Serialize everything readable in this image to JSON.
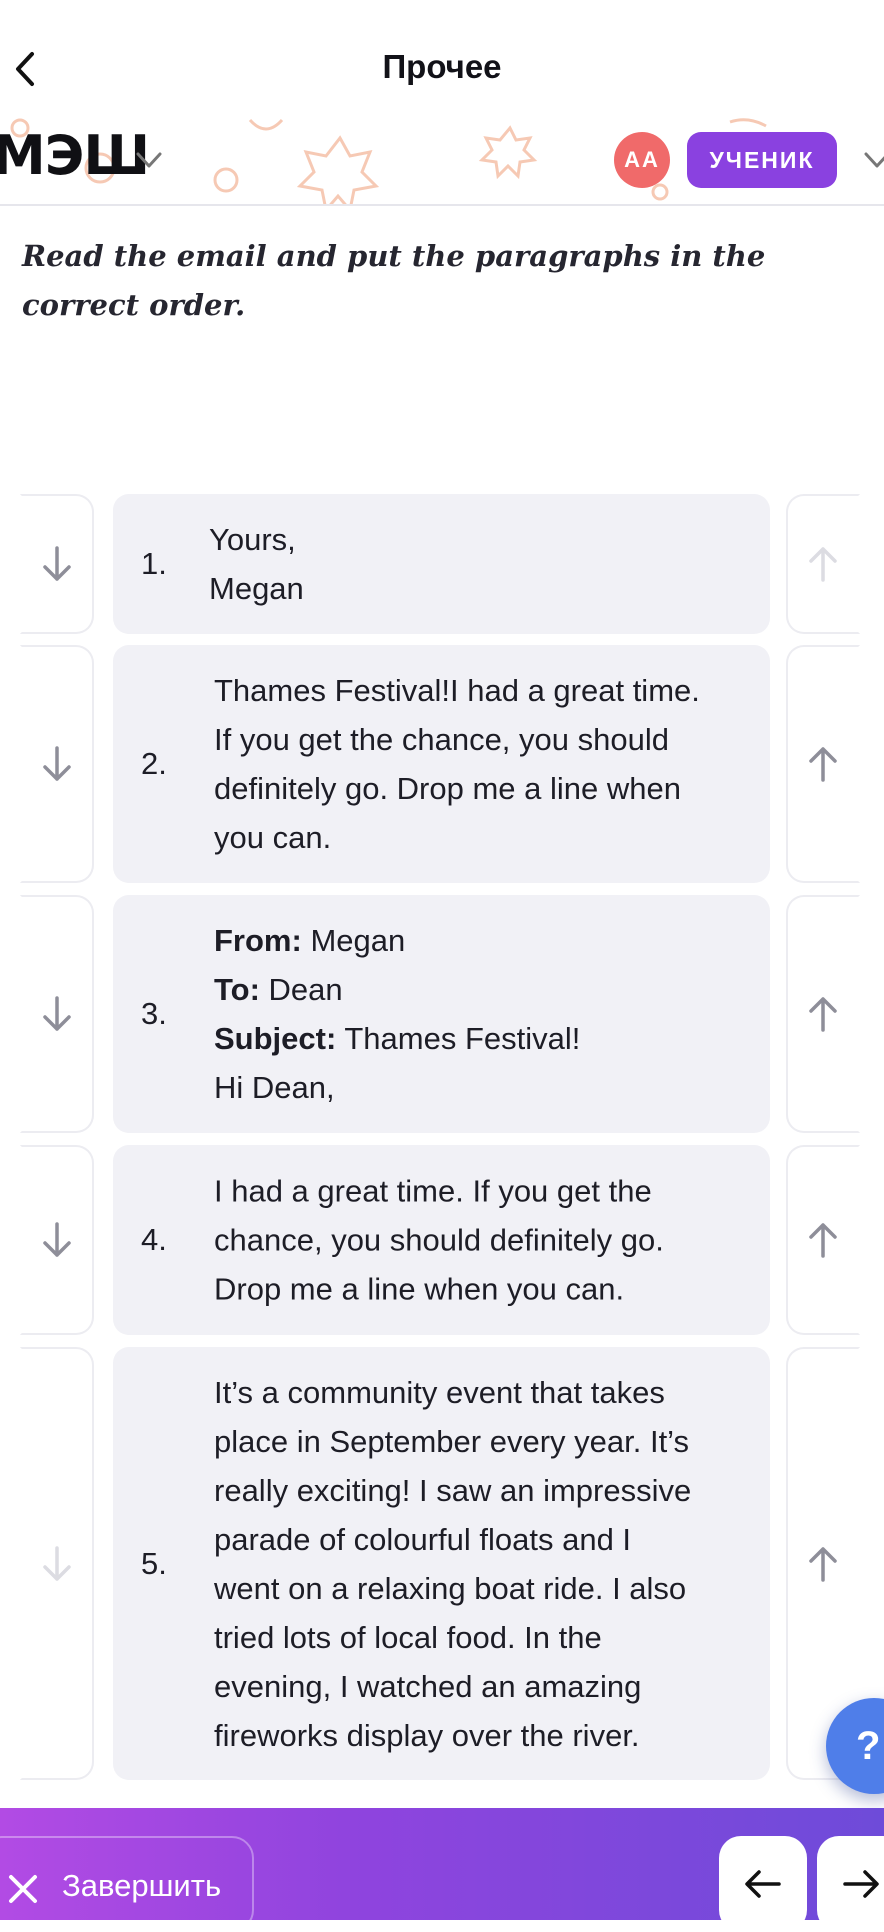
{
  "nav": {
    "title": "Прочее"
  },
  "banner": {
    "logo_text": "ЭШ",
    "logo_prefix": "М",
    "avatar_initials": "AA",
    "role_label": "УЧЕНИК"
  },
  "task": {
    "instruction": "Read the email and put the paragraphs in the correct order."
  },
  "items": [
    {
      "number": "1.",
      "lines": [
        "Yours,",
        "Megan"
      ],
      "down_enabled": true,
      "up_enabled": false
    },
    {
      "number": "2.",
      "lines": [
        "Thames Festival!I had a great time.",
        "If you get the chance, you should",
        "definitely go. Drop me a line when",
        "you can."
      ],
      "down_enabled": true,
      "up_enabled": true
    },
    {
      "number": "3.",
      "lines": [
        {
          "label": "From:",
          "value": " Megan"
        },
        {
          "label": "To:",
          "value": " Dean"
        },
        {
          "label": "Subject:",
          "value": " Thames Festival!"
        },
        {
          "label": "",
          "value": "Hi Dean,"
        }
      ],
      "down_enabled": true,
      "up_enabled": true
    },
    {
      "number": "4.",
      "lines": [
        "I had a great time. If you get the",
        "chance, you should definitely go.",
        "Drop me a line when you can."
      ],
      "down_enabled": true,
      "up_enabled": true
    },
    {
      "number": "5.",
      "lines": [
        "It’s a community event that takes",
        "place in September every year. It’s",
        "really exciting! I saw an impressive",
        "parade of colourful floats and I",
        "went on a relaxing boat ride. I also",
        "tried lots of local food. In the",
        "evening, I watched an amazing",
        "fireworks display over the river."
      ],
      "down_enabled": false,
      "up_enabled": true
    }
  ],
  "help": {
    "label": "?"
  },
  "footer": {
    "finish_label": "Завершить"
  },
  "colors": {
    "accent_purple": "#8a41e0",
    "avatar_red": "#f06a6a",
    "help_blue": "#4f7ee9",
    "card_bg": "#f1f1f6"
  }
}
